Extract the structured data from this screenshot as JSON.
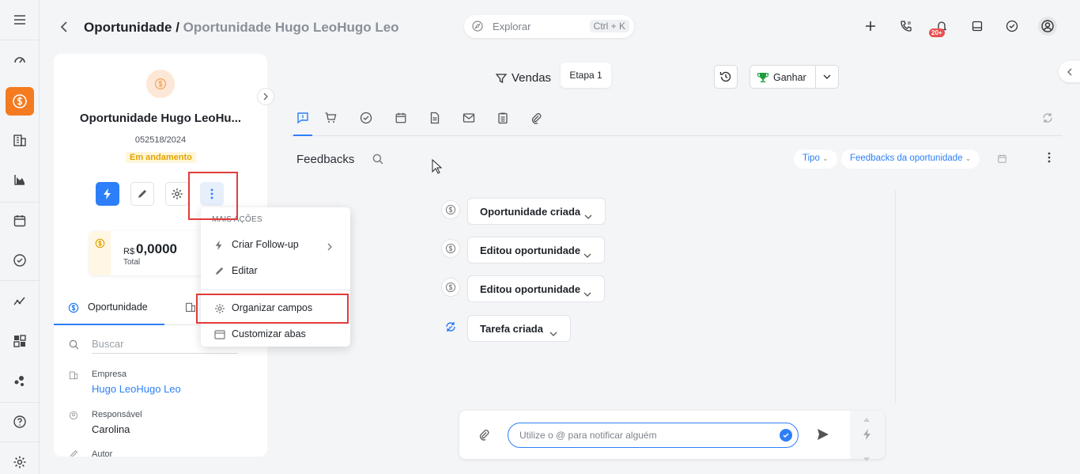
{
  "header": {
    "title": "Oportunidade",
    "separator": "/",
    "subtitle": "Oportunidade Hugo LeoHugo Leo",
    "search_placeholder": "Explorar",
    "search_shortcut": "Ctrl + K",
    "notification_badge": "20+"
  },
  "sidebar": {
    "items": [
      "menu-icon",
      "dashboard-icon",
      "dollar-icon",
      "building-icon",
      "chart-icon",
      "calendar-icon",
      "check-circle-icon",
      "trend-icon",
      "apps-icon",
      "integrations-icon",
      "help-icon",
      "settings-icon"
    ],
    "active": "dollar-icon"
  },
  "card": {
    "title": "Oportunidade Hugo LeoHu...",
    "code": "052518/2024",
    "status": "Em andamento",
    "currency": "R$",
    "amount": "0,0000",
    "amount_label": "Total",
    "tab_label": "Oportunidade",
    "search_placeholder": "Buscar",
    "fields": [
      {
        "label": "Empresa",
        "value": "Hugo LeoHugo Leo"
      },
      {
        "label": "Responsável",
        "value": "Carolina"
      },
      {
        "label": "Autor",
        "value": ""
      }
    ]
  },
  "menu": {
    "header": "MAIS AÇÕES",
    "items": [
      "Criar Follow-up",
      "Editar",
      "Organizar campos",
      "Customizar abas"
    ]
  },
  "pipeline": {
    "funnel": "Vendas",
    "stage": "Etapa 1",
    "win_label": "Ganhar"
  },
  "feedbacks": {
    "title": "Feedbacks",
    "filter_type": "Tipo",
    "filter_scope": "Feedbacks da oportunidade",
    "events": [
      "Oportunidade criada",
      "Editou oportunidade",
      "Editou oportunidade",
      "Tarefa criada"
    ]
  },
  "composer": {
    "placeholder": "Utilize o @ para notificar alguém"
  },
  "colors": {
    "accent": "#2d7ff9",
    "brand": "#f47b20",
    "highlight": "#e23b3b"
  }
}
